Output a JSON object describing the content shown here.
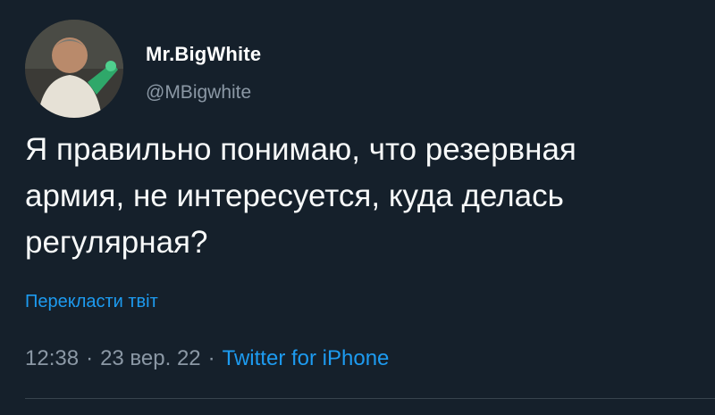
{
  "author": {
    "display_name": "Mr.BigWhite",
    "handle": "@MBigwhite",
    "avatar_icon": "user-avatar-photo"
  },
  "tweet": {
    "text_lines": [
      "Я правильно понимаю, что резервная",
      "армия, не интересуется, куда делась",
      "регулярная?"
    ],
    "translate_label": "Перекласти твіт",
    "time": "12:38",
    "date": "23 вер. 22",
    "separator": "·",
    "source": "Twitter for iPhone"
  },
  "colors": {
    "background": "#15202b",
    "text": "#f7f9f9",
    "secondary": "#8b98a5",
    "accent": "#1d9bf0",
    "divider": "#38444d"
  }
}
